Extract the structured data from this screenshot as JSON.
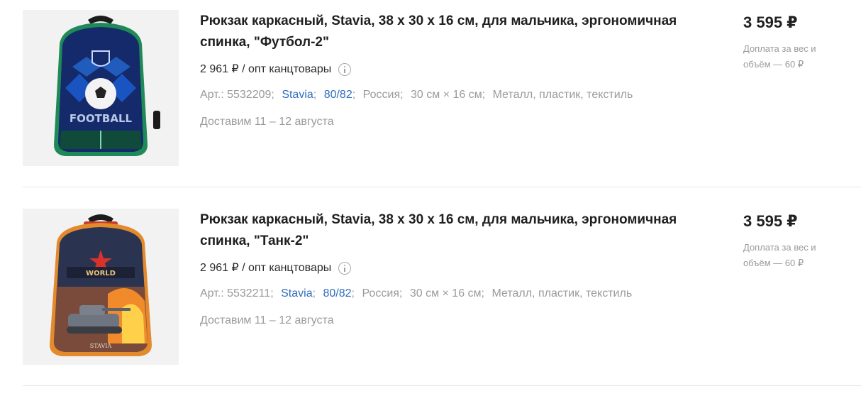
{
  "products": [
    {
      "title": "Рюкзак каркасный, Stavia, 38 х 30 х 16 см, для мальчика, эргономичная спинка, \"Футбол-2\"",
      "opt_price": "2 961 ₽ / опт канцтовары",
      "article": "Арт.: 5532209",
      "brand": "Stavia",
      "size_range": "80/82",
      "country": "Россия",
      "dimensions": "30 см × 16 см",
      "materials": "Металл, пластик, текстиль",
      "delivery": "Доставим 11 – 12 августа",
      "price": "3 595 ₽",
      "surcharge": "Доплата за вес и объём — 60 ₽",
      "image_text": "FOOTBALL"
    },
    {
      "title": "Рюкзак каркасный, Stavia, 38 х 30 х 16 см, для мальчика, эргономичная спинка, \"Танк-2\"",
      "opt_price": "2 961 ₽ / опт канцтовары",
      "article": "Арт.: 5532211",
      "brand": "Stavia",
      "size_range": "80/82",
      "country": "Россия",
      "dimensions": "30 см × 16 см",
      "materials": "Металл, пластик, текстиль",
      "delivery": "Доставим 11 – 12 августа",
      "price": "3 595 ₽",
      "surcharge": "Доплата за вес и объём — 60 ₽",
      "image_text": "STAVIA"
    }
  ],
  "colors": {
    "link": "#2f6dbd",
    "muted": "#9a9a9a",
    "title": "#1f1f1f"
  },
  "icons": [
    "info-icon"
  ]
}
